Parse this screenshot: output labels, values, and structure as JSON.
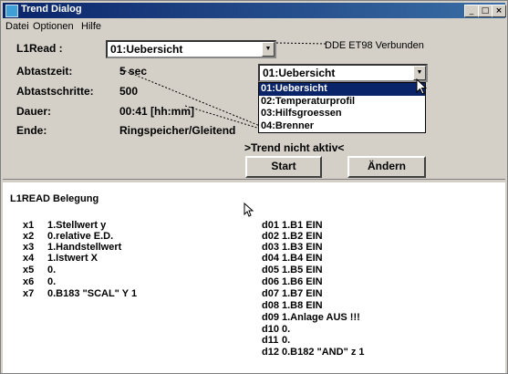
{
  "window": {
    "title": "Trend Dialog",
    "controls": [
      "minimize-icon",
      "maximize-icon",
      "close-icon"
    ]
  },
  "menu": [
    {
      "label": "Datei",
      "accel": "D"
    },
    {
      "label": "Optionen",
      "accel": "O"
    },
    {
      "label": "Hilfe",
      "accel": "H"
    }
  ],
  "form": {
    "l1read_label": "L1Read :",
    "l1read_value": "01:Uebersicht",
    "abtastzeit_label": "Abtastzeit:",
    "abtastzeit_value": "5 sec",
    "abtastschritte_label": "Abtastschritte:",
    "abtastschritte_value": "500",
    "dauer_label": "Dauer:",
    "dauer_value": "00:41 [hh:mm]",
    "ende_label": "Ende:",
    "ende_value": "Ringspeicher/Gleitend"
  },
  "status": {
    "dde_text": "DDE ET98  Verbunden",
    "trend_status": ">Trend nicht aktiv<"
  },
  "combo2": {
    "value": "01:Uebersicht",
    "options": [
      "01:Uebersicht",
      "02:Temperaturprofil",
      "03:Hilfsgroessen",
      "04:Brenner"
    ],
    "selected_index": 0
  },
  "buttons": {
    "start": "Start",
    "aendern": "Ändern"
  },
  "belegung": {
    "title": "L1READ Belegung",
    "left_rows": [
      {
        "id": "x1",
        "text": "1.Stellwert y"
      },
      {
        "id": "x2",
        "text": "0.relative E.D."
      },
      {
        "id": "x3",
        "text": "1.Handstellwert"
      },
      {
        "id": "x4",
        "text": "1.Istwert X"
      },
      {
        "id": "x5",
        "text": "0."
      },
      {
        "id": "x6",
        "text": "0."
      },
      {
        "id": "x7",
        "text": "0.B183 \"SCAL\" Y 1"
      }
    ],
    "right_rows": [
      {
        "id": "d01",
        "text": "1.B1 EIN"
      },
      {
        "id": "d02",
        "text": "1.B2 EIN"
      },
      {
        "id": "d03",
        "text": "1.B3 EIN"
      },
      {
        "id": "d04",
        "text": "1.B4 EIN"
      },
      {
        "id": "d05",
        "text": "1.B5 EIN"
      },
      {
        "id": "d06",
        "text": "1.B6 EIN"
      },
      {
        "id": "d07",
        "text": "1.B7 EIN"
      },
      {
        "id": "d08",
        "text": "1.B8 EIN"
      },
      {
        "id": "d09",
        "text": "1.Anlage AUS !!!"
      },
      {
        "id": "d10",
        "text": "0."
      },
      {
        "id": "d11",
        "text": "0."
      },
      {
        "id": "d12",
        "text": "0.B182 \"AND\" z 1"
      }
    ]
  },
  "colors": {
    "titlebar": "#0a246a",
    "selection": "#0a246a",
    "face": "#d4d0c8"
  }
}
